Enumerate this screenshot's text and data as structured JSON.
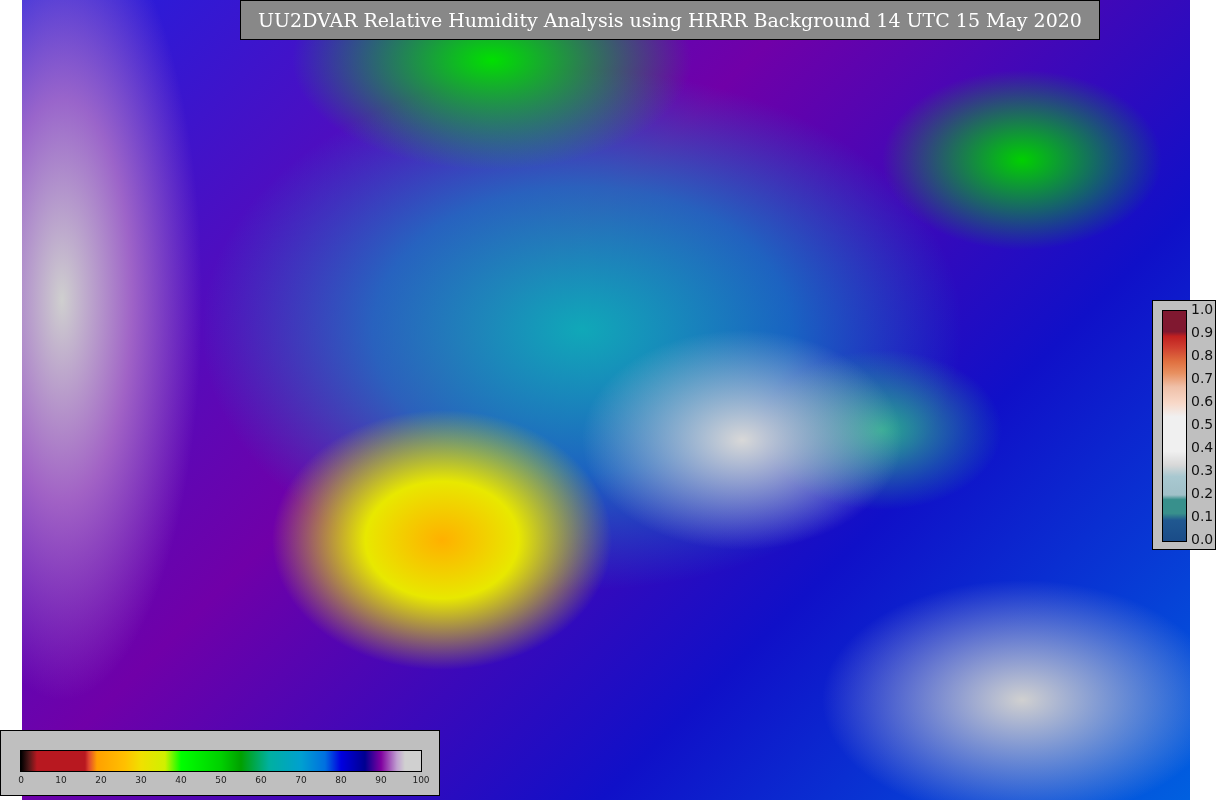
{
  "title": "UU2DVAR Relative Humidity Analysis using HRRR Background 14 UTC 15 May 2020",
  "horizontal_colorbar": {
    "ticks": [
      "0",
      "10",
      "20",
      "30",
      "40",
      "50",
      "60",
      "70",
      "80",
      "90",
      "100"
    ]
  },
  "vertical_colorbar": {
    "ticks": [
      "1.0",
      "0.9",
      "0.8",
      "0.7",
      "0.6",
      "0.5",
      "0.4",
      "0.3",
      "0.2",
      "0.1",
      "0.0"
    ]
  }
}
